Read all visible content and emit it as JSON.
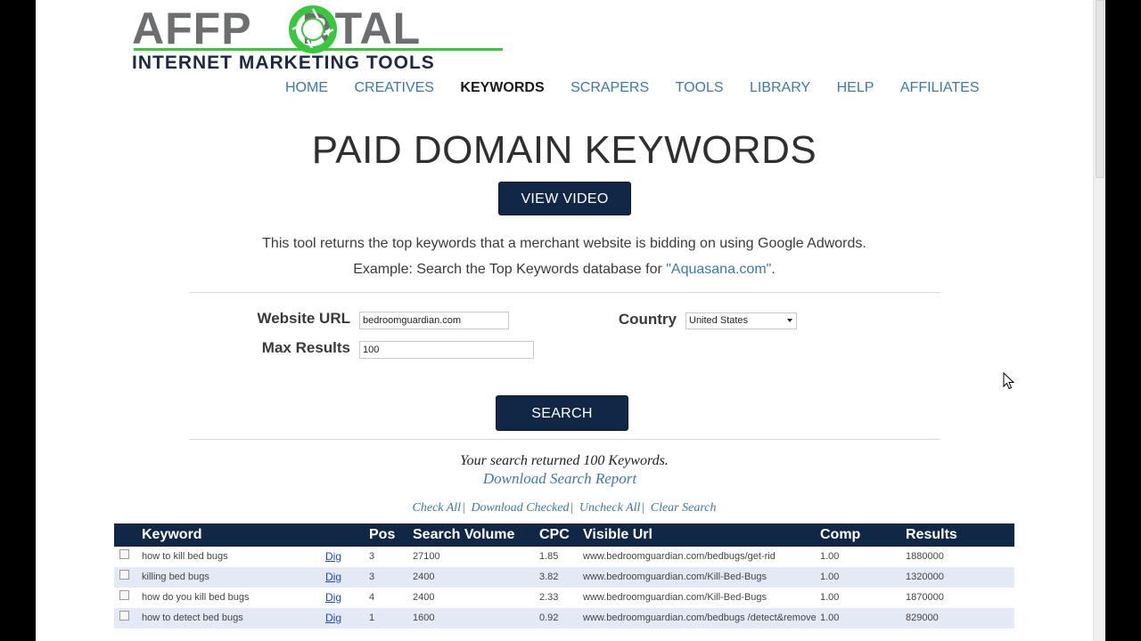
{
  "logo": {
    "word_left": "AFFP",
    "word_right": "RTAL",
    "subtitle": "INTERNET MARKETING TOOLS",
    "colors": {
      "gray": "#6d6e70",
      "green": "#37c93b",
      "navy": "#1c2a44"
    }
  },
  "nav": {
    "items": [
      {
        "label": "HOME"
      },
      {
        "label": "CREATIVES"
      },
      {
        "label": "KEYWORDS"
      },
      {
        "label": "SCRAPERS"
      },
      {
        "label": "TOOLS"
      },
      {
        "label": "LIBRARY"
      },
      {
        "label": "HELP"
      },
      {
        "label": "AFFILIATES"
      }
    ],
    "active": "KEYWORDS"
  },
  "page_title": "PAID DOMAIN KEYWORDS",
  "view_video_label": "VIEW VIDEO",
  "description": {
    "line1": "This tool returns the top keywords that a merchant website is bidding on using Google Adwords.",
    "line2_prefix": "Example: Search the Top Keywords database for ",
    "example_link": "\"Aquasana.com\"",
    "line2_suffix": "."
  },
  "form": {
    "website_label": "Website URL",
    "website_value": "bedroomguardian.com",
    "max_label": "Max Results",
    "max_value": "100",
    "country_label": "Country",
    "country_value": "United States"
  },
  "search_label": "SEARCH",
  "results": {
    "count_text": "Your search returned 100 Keywords.",
    "download_link": "Download Search Report",
    "actions": [
      "Check All",
      "Download Checked",
      "Uncheck All",
      "Clear Search"
    ],
    "separator": "|"
  },
  "table": {
    "headers": {
      "keyword": "Keyword",
      "pos": "Pos",
      "volume": "Search Volume",
      "cpc": "CPC",
      "url": "Visible Url",
      "comp": "Comp",
      "results": "Results"
    },
    "rows": [
      {
        "keyword": "how to kill bed bugs",
        "dig": "Dig",
        "pos": "3",
        "volume": "27100",
        "cpc": "1.85",
        "url": "www.bedroomguardian.com/bedbugs/get-rid",
        "comp": "1.00",
        "results": "1880000"
      },
      {
        "keyword": "killing bed bugs",
        "dig": "Dig",
        "pos": "3",
        "volume": "2400",
        "cpc": "3.82",
        "url": "www.bedroomguardian.com/Kill-Bed-Bugs",
        "comp": "1.00",
        "results": "1320000"
      },
      {
        "keyword": "how do you kill bed bugs",
        "dig": "Dig",
        "pos": "4",
        "volume": "2400",
        "cpc": "2.33",
        "url": "www.bedroomguardian.com/Kill-Bed-Bugs",
        "comp": "1.00",
        "results": "1870000"
      },
      {
        "keyword": "how to detect bed bugs",
        "dig": "Dig",
        "pos": "1",
        "volume": "1600",
        "cpc": "0.92",
        "url": "www.bedroomguardian.com/bedbugs /detect&remove",
        "comp": "1.00",
        "results": "829000"
      }
    ]
  }
}
